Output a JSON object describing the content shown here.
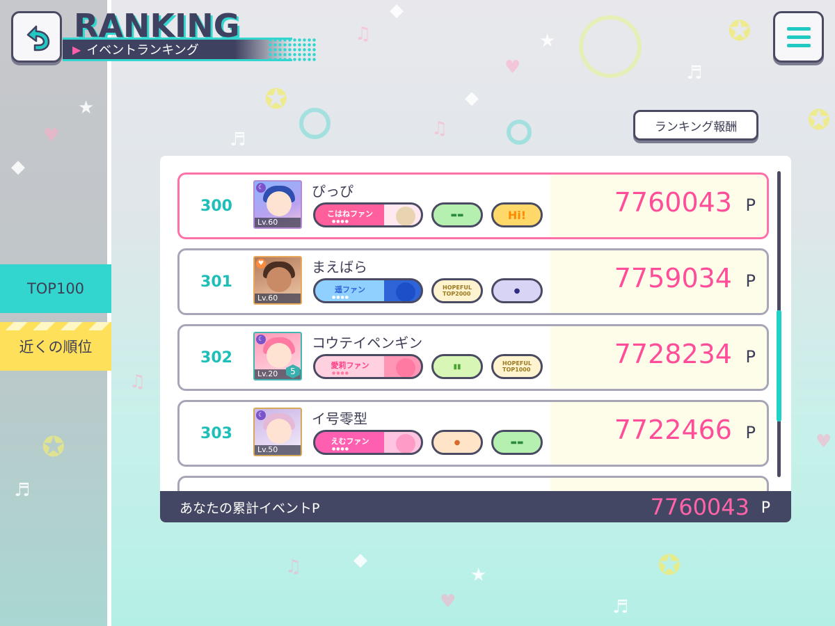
{
  "header": {
    "title": "RANKING",
    "subtitle": "イベントランキング"
  },
  "sidebar": {
    "items": [
      {
        "label": "TOP100",
        "active": true
      },
      {
        "label": "近くの順位",
        "active": false
      }
    ]
  },
  "reward_button": "ランキング報酬",
  "ranking": [
    {
      "rank": "300",
      "name": "ぴっぴ",
      "level": "Lv.60",
      "points": "7760043",
      "unit": "P",
      "title_badge": "こはねファン",
      "badge_color": "#ff5f9c",
      "highlight": true,
      "badges": [
        "penlight",
        "Hi!"
      ]
    },
    {
      "rank": "301",
      "name": "まえばら",
      "level": "Lv.60",
      "points": "7759034",
      "unit": "P",
      "title_badge": "遥ファン",
      "badge_color": "#5fb8f5",
      "highlight": false,
      "badges": [
        "HOPEFUL STAGE TOP2000",
        "character"
      ]
    },
    {
      "rank": "302",
      "name": "コウテイペンギン",
      "level": "Lv.20",
      "master_rank": "5",
      "points": "7728234",
      "unit": "P",
      "title_badge": "愛莉ファン",
      "badge_color": "#ff7eb3",
      "highlight": false,
      "badges": [
        "penlight",
        "HOPEFUL STAGE TOP1000"
      ]
    },
    {
      "rank": "303",
      "name": "イ号零型",
      "level": "Lv.50",
      "points": "7722466",
      "unit": "P",
      "title_badge": "えむファン",
      "badge_color": "#ff5fb0",
      "highlight": false,
      "badges": [
        "character",
        "penlight"
      ]
    }
  ],
  "footer": {
    "label": "あなたの累計イベントP",
    "value": "7760043",
    "unit": "P"
  },
  "colors": {
    "accent": "#33d6cf",
    "pink": "#ff4d9a",
    "yellow": "#ffe05a",
    "dark": "#444763"
  },
  "icons": {
    "back": "back-arrow-icon",
    "menu": "hamburger-menu-icon"
  }
}
